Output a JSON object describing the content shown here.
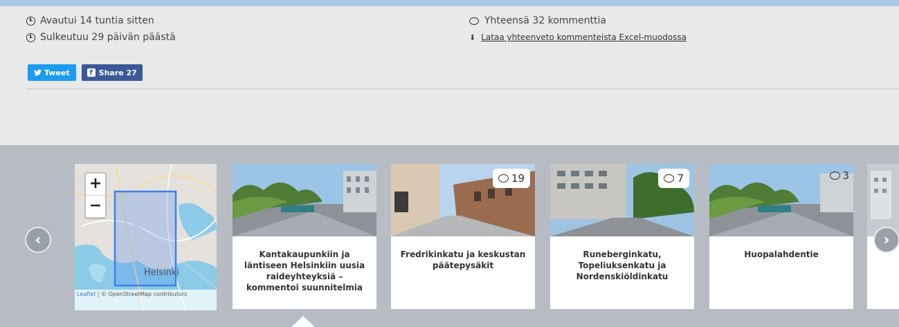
{
  "info": {
    "opened": "Avautui 14 tuntia sitten",
    "closes": "Sulkeutuu 29 päivän päästä",
    "comments_total": "Yhteensä 32 kommenttia",
    "download_link": "Lataa yhteenveto kommenteista Excel-muodossa"
  },
  "share": {
    "tweet_label": "Tweet",
    "share_label": "Share 27"
  },
  "map": {
    "zoom_in": "+",
    "zoom_out": "−",
    "city_label": "Helsinki",
    "attribution_leaflet": "Leaflet",
    "attribution_rest": " | © OpenStreetMap contributors"
  },
  "cards": [
    {
      "title": "Kantakaupunkiin ja läntiseen Helsinkiin uusia raideyhteyksiä – kommentoi suunnitelmia",
      "comments": ""
    },
    {
      "title": "Fredrikinkatu ja keskustan päätepysäkit",
      "comments": "19"
    },
    {
      "title": "Runeberginkatu, Topeliuksenkatu ja Nordenskiöldinkatu",
      "comments": "7"
    },
    {
      "title": "Huopalahdentie",
      "comments": "3"
    }
  ],
  "nav": {
    "prev": "‹",
    "next": "›"
  },
  "colors": {
    "accent_bar": "#a9c9e6",
    "carousel_bg": "#b7bcc4",
    "twitter": "#1d9bf0",
    "facebook": "#3b5998"
  }
}
